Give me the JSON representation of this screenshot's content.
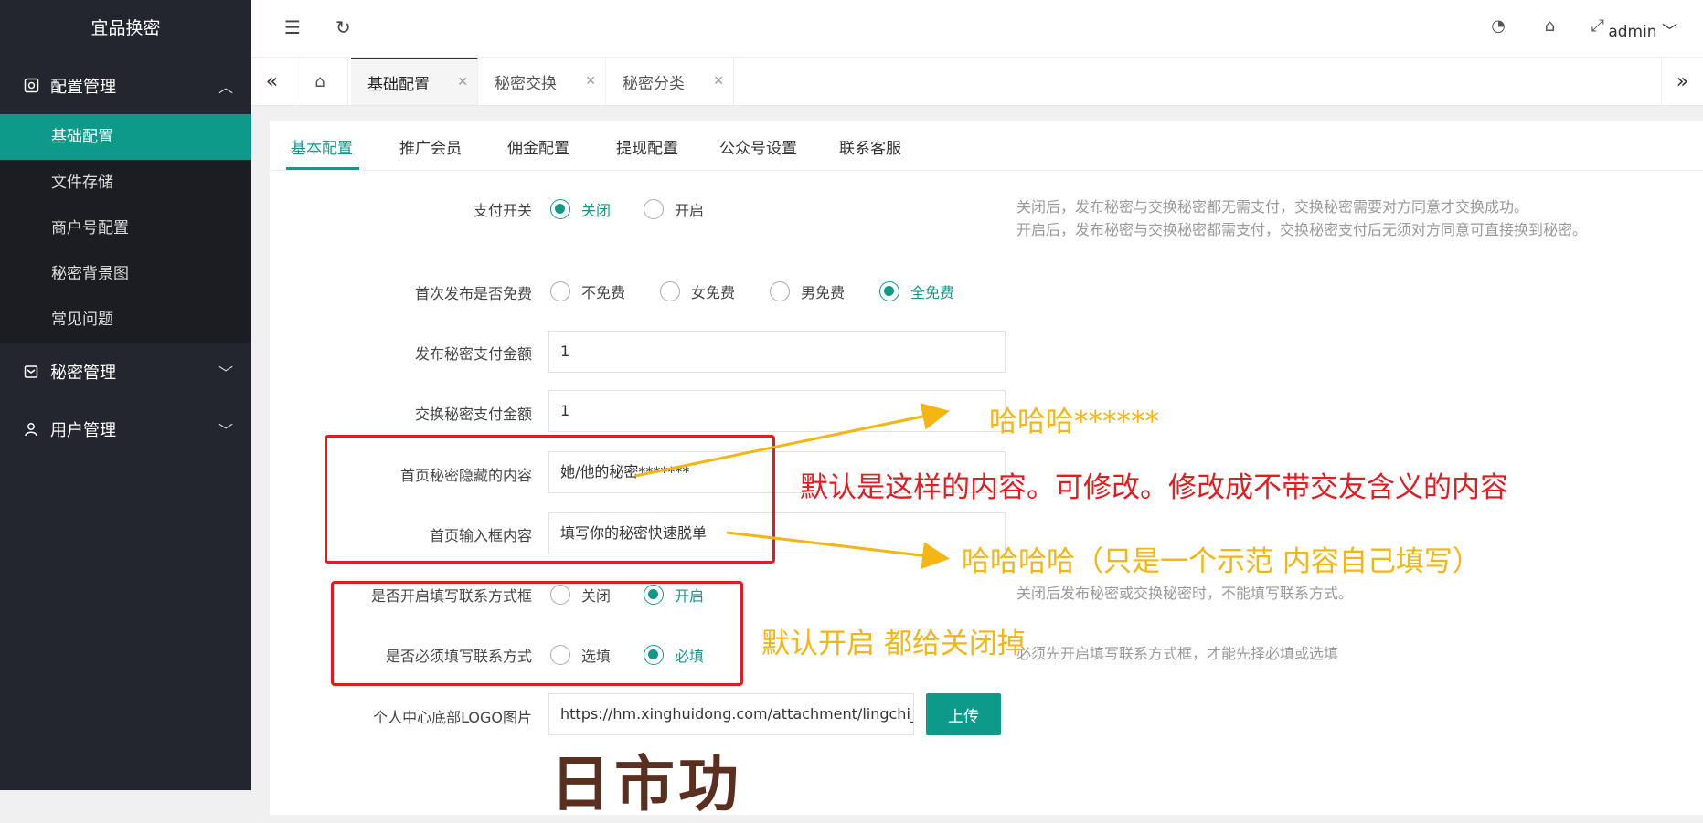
{
  "sidebar": {
    "brand": "宜品换密",
    "groups": [
      {
        "label": "配置管理",
        "icon": "settings-icon",
        "expanded": true,
        "items": [
          "基础配置",
          "文件存储",
          "商户号配置",
          "秘密背景图",
          "常见问题"
        ]
      },
      {
        "label": "秘密管理",
        "icon": "secret-icon",
        "expanded": false
      },
      {
        "label": "用户管理",
        "icon": "user-icon",
        "expanded": false
      }
    ]
  },
  "topbar": {
    "user": "admin",
    "icons": [
      "menu-fold-icon",
      "refresh-icon",
      "theme-icon",
      "tag-icon",
      "fullscreen-icon"
    ]
  },
  "tabs": {
    "items": [
      "基础配置",
      "秘密交换",
      "秘密分类"
    ],
    "active": 0
  },
  "subtabs": {
    "items": [
      "基本配置",
      "推广会员",
      "佣金配置",
      "提现配置",
      "公众号设置",
      "联系客服"
    ],
    "active": 0
  },
  "form": {
    "pay_switch": {
      "label": "支付开关",
      "options": [
        "关闭",
        "开启"
      ],
      "selected": "关闭",
      "help": [
        "关闭后，发布秘密与交换秘密都无需支付，交换秘密需要对方同意才交换成功。",
        "开启后，发布秘密与交换秘密都需支付，交换秘密支付后无须对方同意可直接换到秘密。"
      ]
    },
    "first_free": {
      "label": "首次发布是否免费",
      "options": [
        "不免费",
        "女免费",
        "男免费",
        "全免费"
      ],
      "selected": "全免费"
    },
    "publish_amount": {
      "label": "发布秘密支付金额",
      "value": "1"
    },
    "exchange_amount": {
      "label": "交换秘密支付金额",
      "value": "1"
    },
    "hidden_content": {
      "label": "首页秘密隐藏的内容",
      "value": "她/他的秘密*******"
    },
    "input_content": {
      "label": "首页输入框内容",
      "value": "填写你的秘密快速脱单"
    },
    "contact_switch": {
      "label": "是否开启填写联系方式框",
      "options": [
        "关闭",
        "开启"
      ],
      "selected": "开启",
      "help": "关闭后发布秘密或交换秘密时，不能填写联系方式。"
    },
    "contact_required": {
      "label": "是否必须填写联系方式",
      "options": [
        "选填",
        "必填"
      ],
      "selected": "必填",
      "help": "必须先开启填写联系方式框，才能先择必填或选填"
    },
    "logo": {
      "label": "个人中心底部LOGO图片",
      "value": "https://hm.xinghuidong.com/attachment/lingchi_se",
      "upload": "上传",
      "preview_text": "日市功"
    }
  },
  "annotations": {
    "note1": "哈哈哈******",
    "note2": "默认是这样的内容。可修改。修改成不带交友含义的内容",
    "note3": "哈哈哈哈（只是一个示范 内容自己填写）",
    "note4": "默认开启 都给关闭掉",
    "colors": {
      "red": "#e8191f",
      "orange": "#f5b512"
    }
  },
  "theme": {
    "accent": "#0e9a8a",
    "sidebar_bg": "#23262e"
  }
}
